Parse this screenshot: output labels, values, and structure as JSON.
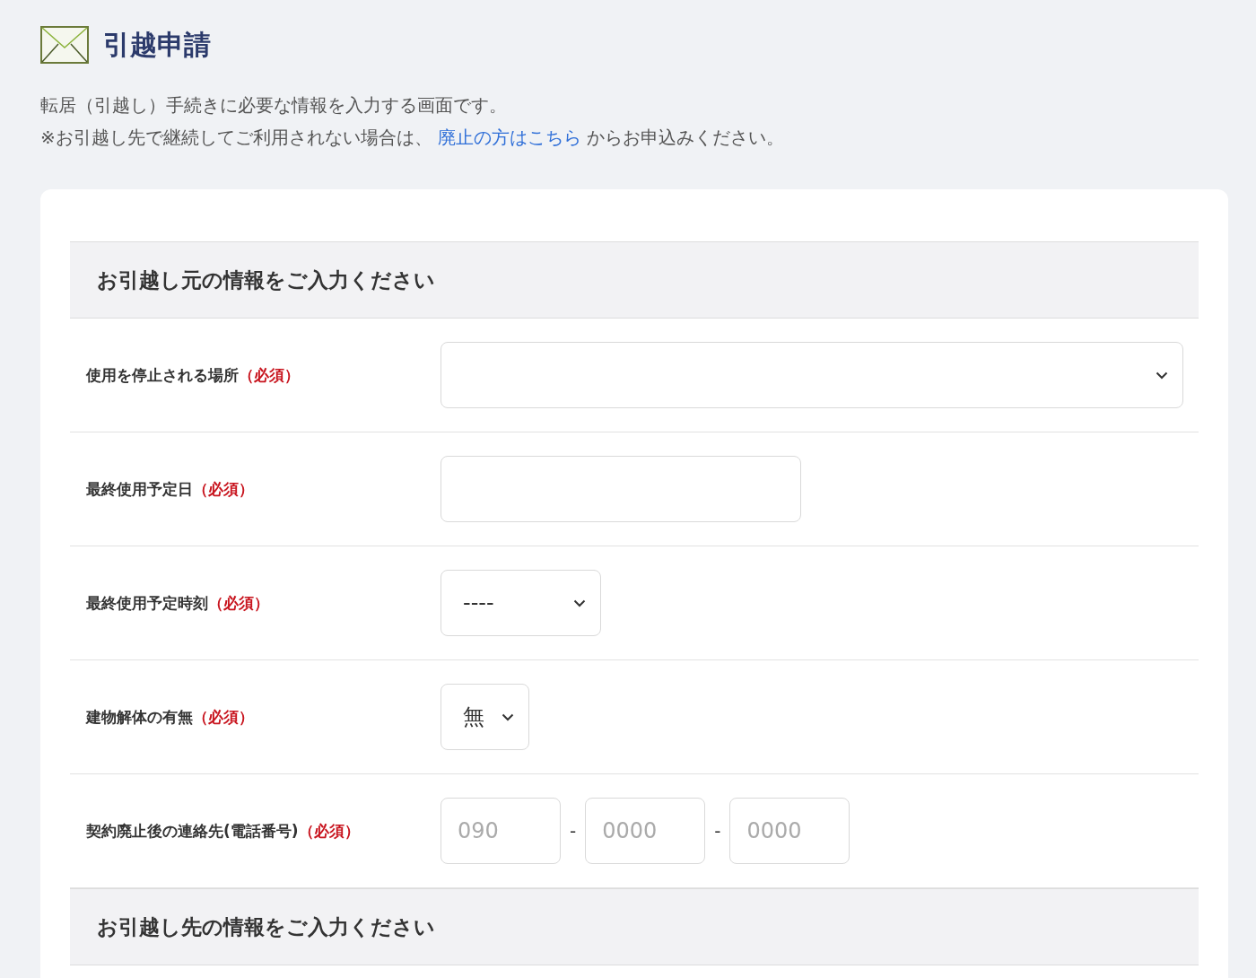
{
  "page": {
    "title": "引越申請",
    "description": "転居（引越し）手続きに必要な情報を入力する画面です。",
    "note_before": "※お引越し先で継続してご利用されない場合は、",
    "note_link": "廃止の方はこちら",
    "note_after": "からお申込みください。"
  },
  "sections": [
    {
      "heading": "お引越し元の情報をご入力ください",
      "fields": [
        {
          "kind": "select",
          "label": "使用を停止される場所",
          "required": "（必須）"
        },
        {
          "kind": "input",
          "label": "最終使用予定日",
          "required": "（必須）"
        },
        {
          "kind": "select",
          "label": "最終使用予定時刻",
          "required": "（必須）",
          "value": "----"
        },
        {
          "kind": "select",
          "label": "建物解体の有無",
          "required": "（必須）",
          "value": "無"
        },
        {
          "kind": "phone",
          "label": "契約廃止後の連絡先(電話番号)",
          "required": "（必須）",
          "parts": [
            {
              "placeholder": "090"
            },
            {
              "placeholder": "0000"
            },
            {
              "placeholder": "0000"
            }
          ],
          "separator": "-"
        }
      ]
    },
    {
      "heading": "お引越し先の情報をご入力ください"
    }
  ]
}
